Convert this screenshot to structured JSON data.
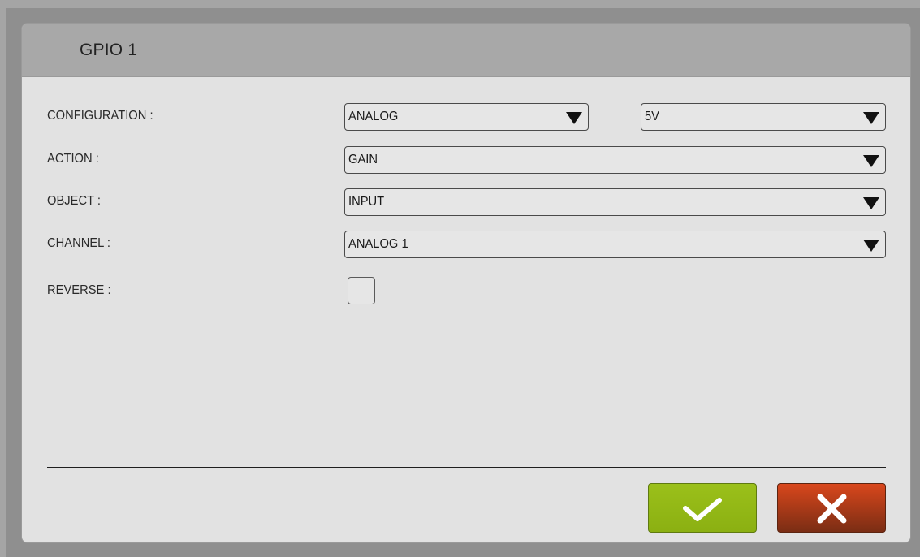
{
  "dialog": {
    "title": "GPIO 1"
  },
  "fields": {
    "configuration": {
      "label": "CONFIGURATION :",
      "mode_value": "ANALOG",
      "voltage_value": "5V"
    },
    "action": {
      "label": "ACTION :",
      "value": "GAIN"
    },
    "object": {
      "label": "OBJECT :",
      "value": "INPUT"
    },
    "channel": {
      "label": "CHANNEL :",
      "value": "ANALOG 1"
    },
    "reverse": {
      "label": "REVERSE :",
      "checked": false
    }
  },
  "buttons": {
    "confirm_icon": "checkmark-icon",
    "cancel_icon": "close-icon"
  },
  "colors": {
    "confirm": "#9bc01a",
    "cancel": "#c8421a"
  }
}
